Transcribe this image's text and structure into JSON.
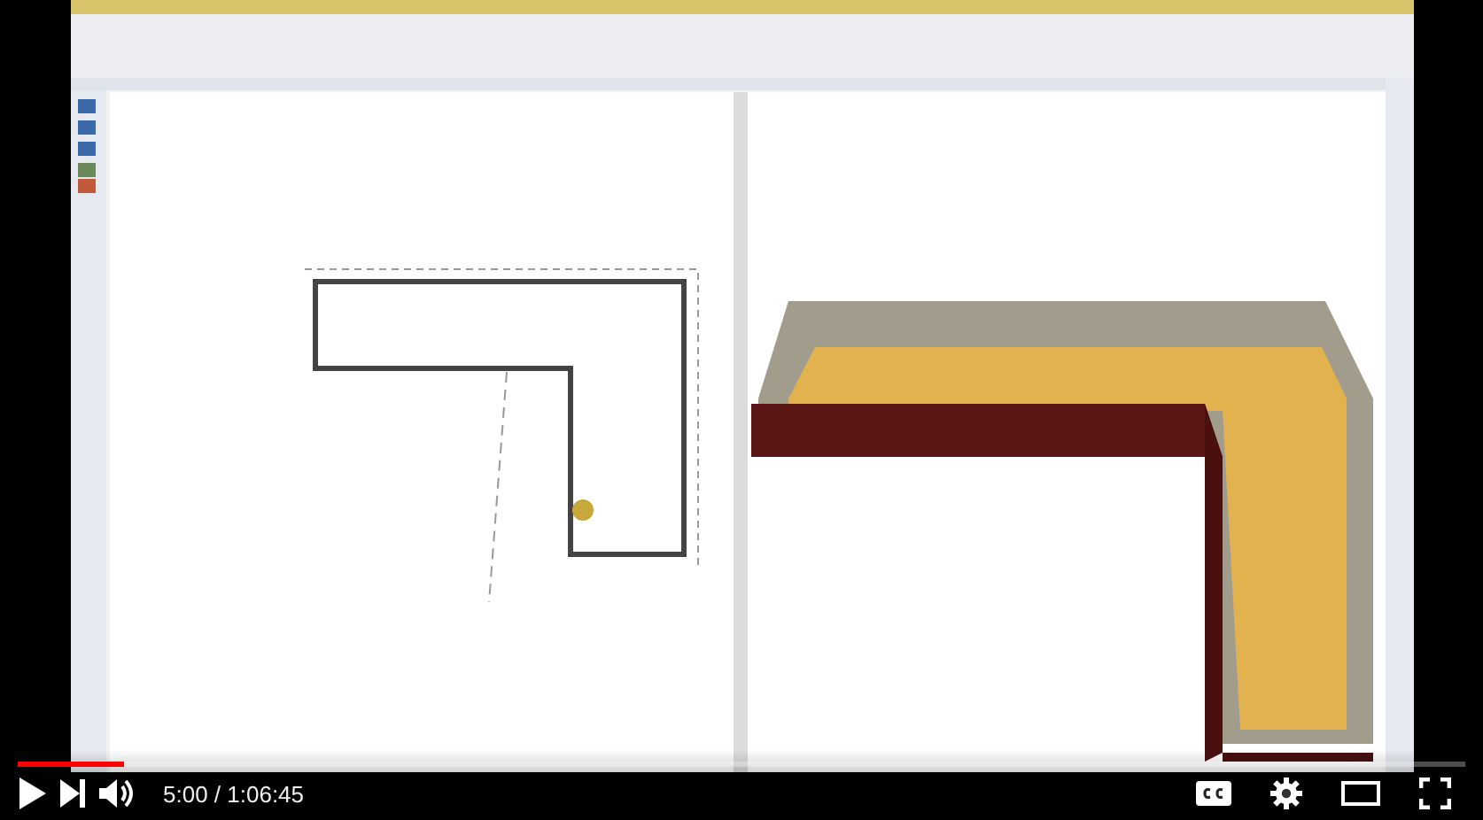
{
  "player": {
    "playing": false,
    "progress": {
      "level": 0.074
    },
    "time": "5:00 / 1:06:45"
  }
}
